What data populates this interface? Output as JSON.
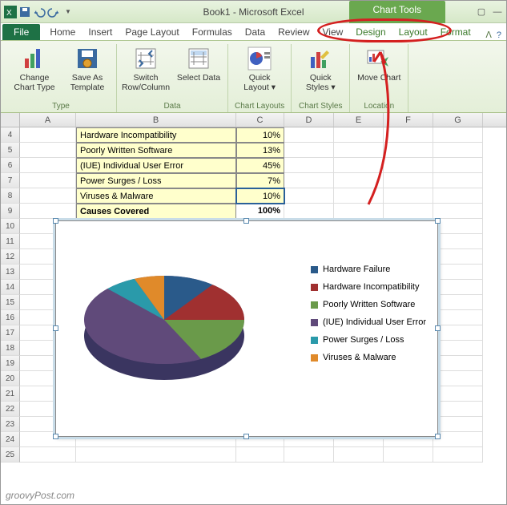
{
  "title": "Book1 - Microsoft Excel",
  "contextual_tab_title": "Chart Tools",
  "ribbon_tabs": {
    "file": "File",
    "items": [
      "Home",
      "Insert",
      "Page Layout",
      "Formulas",
      "Data",
      "Review",
      "View"
    ],
    "ctx": [
      "Design",
      "Layout",
      "Format"
    ]
  },
  "ribbon": {
    "groups": [
      {
        "label": "Type",
        "buttons": [
          {
            "name": "change-chart-type",
            "label": "Change Chart Type"
          },
          {
            "name": "save-as-template",
            "label": "Save As Template"
          }
        ]
      },
      {
        "label": "Data",
        "buttons": [
          {
            "name": "switch-row-col",
            "label": "Switch Row/Column"
          },
          {
            "name": "select-data",
            "label": "Select Data"
          }
        ]
      },
      {
        "label": "Chart Layouts",
        "buttons": [
          {
            "name": "quick-layout",
            "label": "Quick Layout ▾"
          }
        ]
      },
      {
        "label": "Chart Styles",
        "buttons": [
          {
            "name": "quick-styles",
            "label": "Quick Styles ▾"
          }
        ]
      },
      {
        "label": "Location",
        "buttons": [
          {
            "name": "move-chart",
            "label": "Move Chart"
          }
        ]
      }
    ]
  },
  "columns": [
    "A",
    "B",
    "C",
    "D",
    "E",
    "F",
    "G"
  ],
  "rows": [
    {
      "n": 4,
      "b": "Hardware Incompatibility",
      "c": "10%"
    },
    {
      "n": 5,
      "b": "Poorly Written Software",
      "c": "13%"
    },
    {
      "n": 6,
      "b": "(IUE) Individual User Error",
      "c": "45%"
    },
    {
      "n": 7,
      "b": "Power Surges / Loss",
      "c": "7%"
    },
    {
      "n": 8,
      "b": "Viruses & Malware",
      "c": "10%"
    },
    {
      "n": 9,
      "b": "Causes Covered",
      "c": "100%",
      "bold": true
    }
  ],
  "empty_rows": [
    10,
    11,
    12,
    13,
    14,
    15,
    16,
    17,
    18,
    19,
    20,
    21,
    22,
    23,
    24,
    25
  ],
  "legend": [
    {
      "label": "Hardware Failure",
      "color": "#2a5a8a"
    },
    {
      "label": "Hardware Incompatibility",
      "color": "#a03030"
    },
    {
      "label": "Poorly Written Software",
      "color": "#6a9a4a"
    },
    {
      "label": "(IUE) Individual User Error",
      "color": "#604a7a"
    },
    {
      "label": "Power Surges / Loss",
      "color": "#2a9aaa"
    },
    {
      "label": "Viruses & Malware",
      "color": "#e08a2a"
    }
  ],
  "chart_data": {
    "type": "pie",
    "categories": [
      "Hardware Failure",
      "Hardware Incompatibility",
      "Poorly Written Software",
      "(IUE) Individual User Error",
      "Power Surges / Loss",
      "Viruses & Malware"
    ],
    "values": [
      15,
      10,
      13,
      45,
      7,
      10
    ],
    "colors": [
      "#2a5a8a",
      "#a03030",
      "#6a9a4a",
      "#604a7a",
      "#2a9aaa",
      "#e08a2a"
    ],
    "title": ""
  },
  "watermark": "groovyPost.com"
}
